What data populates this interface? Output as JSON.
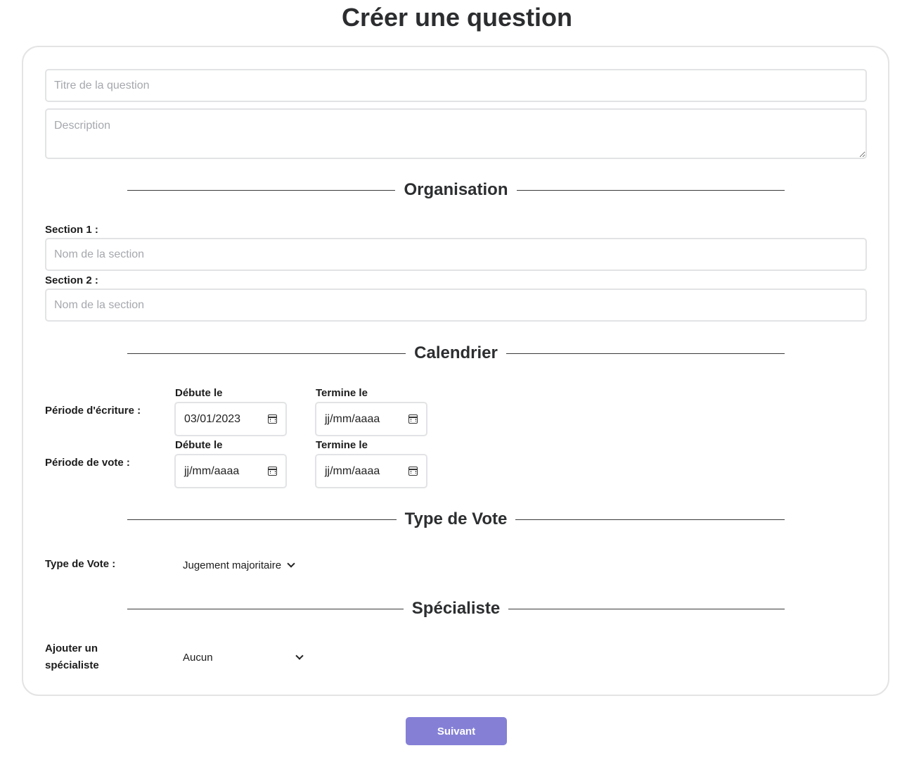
{
  "page": {
    "title": "Créer une question"
  },
  "question": {
    "title_placeholder": "Titre de la question",
    "description_placeholder": "Description"
  },
  "organisation": {
    "heading": "Organisation",
    "sections": [
      {
        "label": "Section 1 :",
        "placeholder": "Nom de la section"
      },
      {
        "label": "Section 2 :",
        "placeholder": "Nom de la section"
      }
    ]
  },
  "calendrier": {
    "heading": "Calendrier",
    "periods": [
      {
        "label": "Période d'écriture :",
        "start_label": "Débute le",
        "start_value": "03/01/2023",
        "end_label": "Termine le",
        "end_value": "jj/mm/aaaa"
      },
      {
        "label": "Période de vote :",
        "start_label": "Débute le",
        "start_value": "jj/mm/aaaa",
        "end_label": "Termine le",
        "end_value": "jj/mm/aaaa"
      }
    ]
  },
  "type_de_vote": {
    "heading": "Type de Vote",
    "label": "Type de Vote :",
    "selected": "Jugement majoritaire"
  },
  "specialiste": {
    "heading": "Spécialiste",
    "label_line1": "Ajouter un",
    "label_line2": "spécialiste",
    "selected": "Aucun"
  },
  "actions": {
    "next_label": "Suivant"
  },
  "colors": {
    "primary_button": "#8580d6",
    "input_border": "#e2e3e5",
    "card_border": "#e4e4e4"
  },
  "icons": {
    "date_picker": "calendar-icon",
    "dropdown": "chevron-down-icon"
  }
}
